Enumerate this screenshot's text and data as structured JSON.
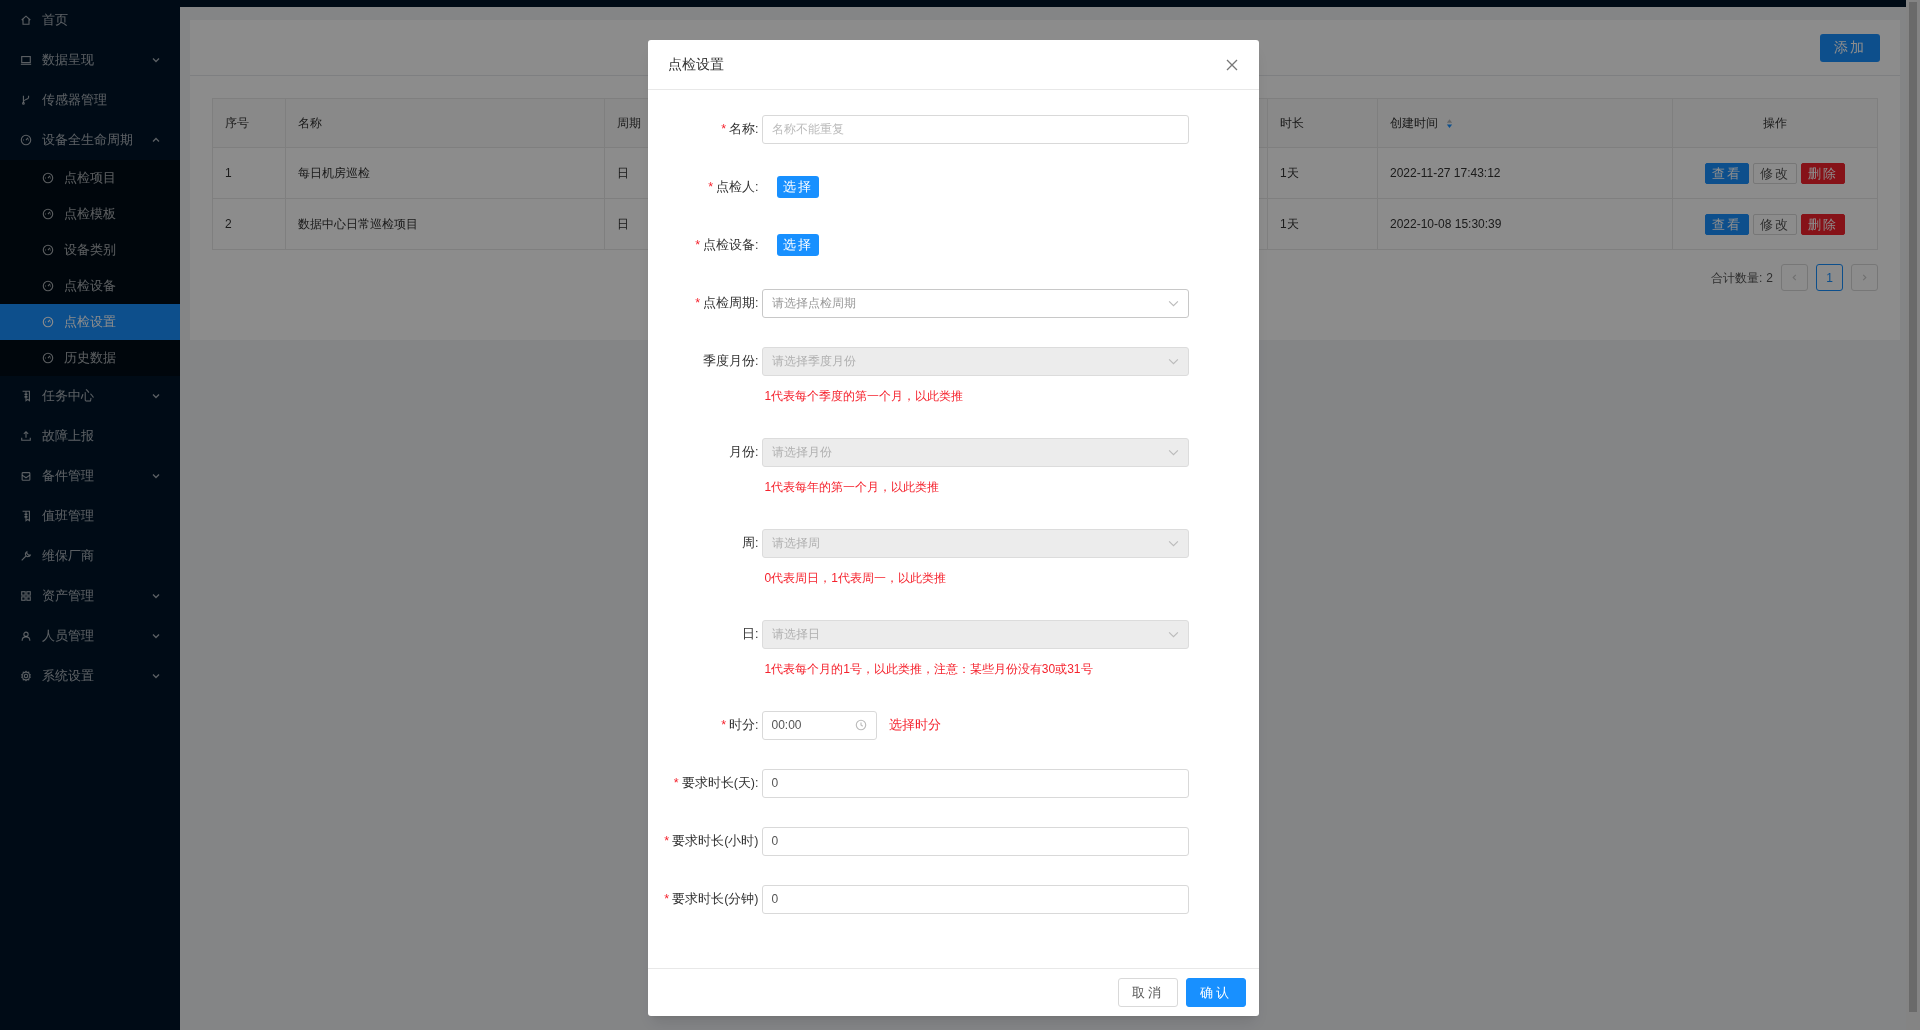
{
  "sidebar": {
    "items": [
      {
        "label": "首页",
        "selected": false
      },
      {
        "label": "数据呈现",
        "selected": false,
        "expanded": false
      },
      {
        "label": "传感器管理",
        "selected": false
      },
      {
        "label": "设备全生命周期",
        "selected": false,
        "expanded": true,
        "children": [
          {
            "label": "点检项目",
            "selected": false
          },
          {
            "label": "点检模板",
            "selected": false
          },
          {
            "label": "设备类别",
            "selected": false
          },
          {
            "label": "点检设备",
            "selected": false
          },
          {
            "label": "点检设置",
            "selected": true
          },
          {
            "label": "历史数据",
            "selected": false
          }
        ]
      },
      {
        "label": "任务中心",
        "selected": false,
        "expanded": false
      },
      {
        "label": "故障上报",
        "selected": false
      },
      {
        "label": "备件管理",
        "selected": false,
        "expanded": false
      },
      {
        "label": "值班管理",
        "selected": false
      },
      {
        "label": "维保厂商",
        "selected": false
      },
      {
        "label": "资产管理",
        "selected": false,
        "expanded": false
      },
      {
        "label": "人员管理",
        "selected": false,
        "expanded": false
      },
      {
        "label": "系统设置",
        "selected": false,
        "expanded": false
      }
    ]
  },
  "toolbar": {
    "add_button": "添加"
  },
  "table": {
    "columns": [
      {
        "label": "序号"
      },
      {
        "label": "名称"
      },
      {
        "label": "周期"
      },
      {
        "label": "时长"
      },
      {
        "label": "创建时间",
        "sortable": true
      },
      {
        "label": "操作"
      }
    ],
    "rows": [
      {
        "cells": [
          "1",
          "每日机房巡检",
          "日",
          "1天",
          "2022-11-27 17:43:12"
        ],
        "actions": [
          {
            "label": "查看",
            "kind": "primary"
          },
          {
            "label": "修改",
            "kind": "default"
          },
          {
            "label": "删除",
            "kind": "danger"
          }
        ]
      },
      {
        "cells": [
          "2",
          "数据中心日常巡检项目",
          "日",
          "1天",
          "2022-10-08 15:30:39"
        ],
        "actions": [
          {
            "label": "查看",
            "kind": "primary"
          },
          {
            "label": "修改",
            "kind": "default"
          },
          {
            "label": "删除",
            "kind": "danger"
          }
        ]
      }
    ]
  },
  "pagination": {
    "total_label": "合计数量:",
    "total": "2",
    "pages": [
      {
        "label": "1",
        "selected": true
      }
    ]
  },
  "dialog": {
    "title": "点检设置",
    "fields": [
      {
        "kind": "input",
        "label": "名称:",
        "required_mark": "*",
        "placeholder": "名称不能重复"
      },
      {
        "kind": "button",
        "label": "点检人:",
        "required_mark": "*",
        "button": "选择"
      },
      {
        "kind": "button",
        "label": "点检设备:",
        "required_mark": "*",
        "button": "选择"
      },
      {
        "kind": "select",
        "label": "点检周期:",
        "required_mark": "*",
        "placeholder": "请选择点检周期",
        "disabled": false
      },
      {
        "kind": "select",
        "label": "季度月份:",
        "placeholder": "请选择季度月份",
        "disabled": true,
        "hint": "1代表每个季度的第一个月，以此类推"
      },
      {
        "kind": "select",
        "label": "月份:",
        "placeholder": "请选择月份",
        "disabled": true,
        "hint": "1代表每年的第一个月，以此类推"
      },
      {
        "kind": "select",
        "label": "周:",
        "placeholder": "请选择周",
        "disabled": true,
        "hint": "0代表周日，1代表周一，以此类推"
      },
      {
        "kind": "select",
        "label": "日:",
        "placeholder": "请选择日",
        "disabled": true,
        "hint": "1代表每个月的1号，以此类推，注意：某些月份没有30或31号"
      },
      {
        "kind": "time",
        "label": "时分:",
        "required_mark": "*",
        "value": "00:00",
        "note": "选择时分"
      },
      {
        "kind": "input",
        "label": "要求时长(天):",
        "required_mark": "*",
        "value": "0"
      },
      {
        "kind": "input",
        "label": "要求时长(小时)",
        "required_mark": "*",
        "value": "0"
      },
      {
        "kind": "input",
        "label": "要求时长(分钟)",
        "required_mark": "*",
        "value": "0"
      }
    ],
    "buttons": [
      {
        "label": "取消",
        "kind": "default"
      },
      {
        "label": "确认",
        "kind": "primary"
      }
    ]
  }
}
